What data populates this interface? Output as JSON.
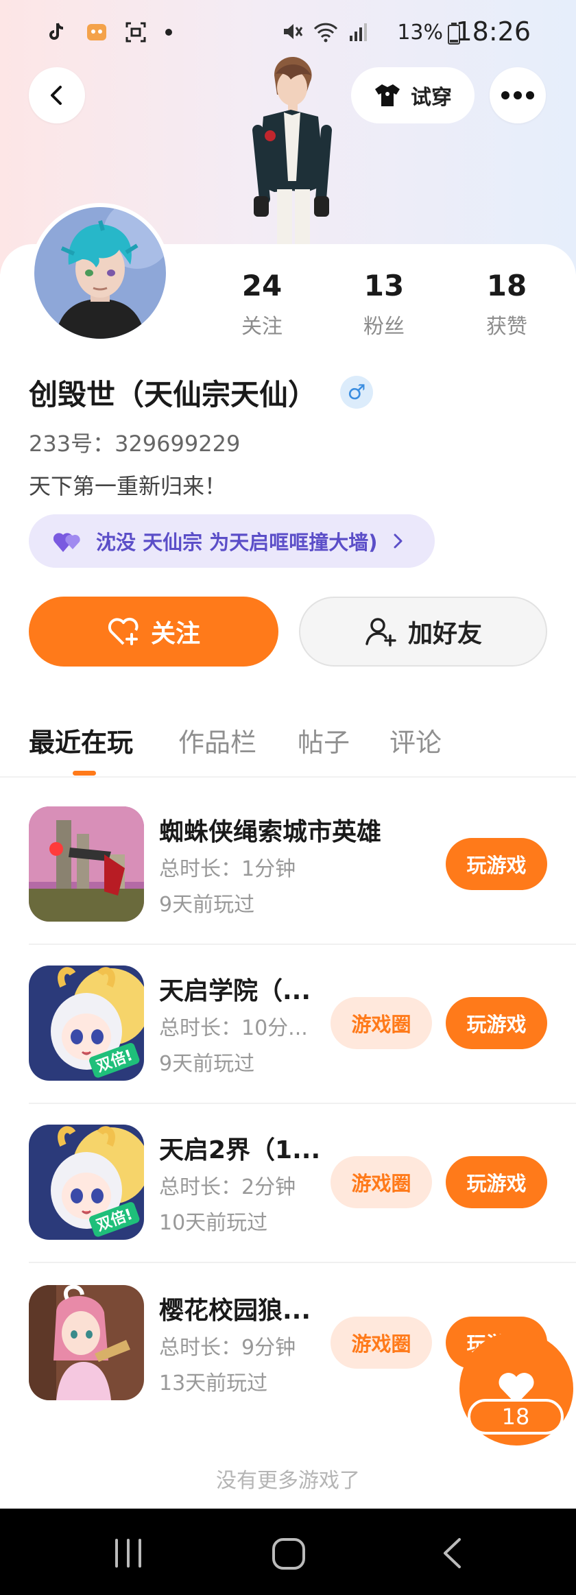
{
  "status_bar": {
    "time": "18:26",
    "battery": "13%",
    "left_icons": [
      "tiktok-icon",
      "app-icon",
      "screenshot-icon",
      "dot-icon"
    ],
    "right_icons": [
      "mute-icon",
      "wifi-icon",
      "signal-icon",
      "battery-icon"
    ]
  },
  "header": {
    "try_on_label": "试穿"
  },
  "stats": [
    {
      "value": "24",
      "label": "关注"
    },
    {
      "value": "13",
      "label": "粉丝"
    },
    {
      "value": "18",
      "label": "获赞"
    }
  ],
  "profile": {
    "name": "创毁世（天仙宗天仙）",
    "gender_symbol": "♂",
    "uid": "233号：329699229",
    "bio": "天下第一重新归来！",
    "guild": "沈没 天仙宗 为天启哐哐撞大墙)"
  },
  "actions": {
    "follow_label": "关注",
    "add_friend_label": "加好友"
  },
  "tabs": [
    {
      "label": "最近在玩",
      "active": true
    },
    {
      "label": "作品栏",
      "active": false
    },
    {
      "label": "帖子",
      "active": false
    },
    {
      "label": "评论",
      "active": false
    }
  ],
  "games": [
    {
      "title": "蜘蛛侠绳索城市英雄",
      "duration": "总时长：1分钟",
      "last_played": "9天前玩过",
      "circle_label": "",
      "play_label": "玩游戏"
    },
    {
      "title": "天启学院（...",
      "duration": "总时长：10分...",
      "last_played": "9天前玩过",
      "circle_label": "游戏圈",
      "play_label": "玩游戏"
    },
    {
      "title": "天启2界（1...",
      "duration": "总时长：2分钟",
      "last_played": "10天前玩过",
      "circle_label": "游戏圈",
      "play_label": "玩游戏"
    },
    {
      "title": "樱花校园狼...",
      "duration": "总时长：9分钟",
      "last_played": "13天前玩过",
      "circle_label": "游戏圈",
      "play_label": "玩游戏"
    }
  ],
  "game_icon_badge": "双倍!",
  "footer": {
    "no_more": "没有更多游戏了"
  },
  "like_fab": {
    "count": "18"
  },
  "colors": {
    "accent": "#ff7a1a",
    "guild_bg": "#ebe8fb",
    "guild_text": "#5b4ec8"
  }
}
